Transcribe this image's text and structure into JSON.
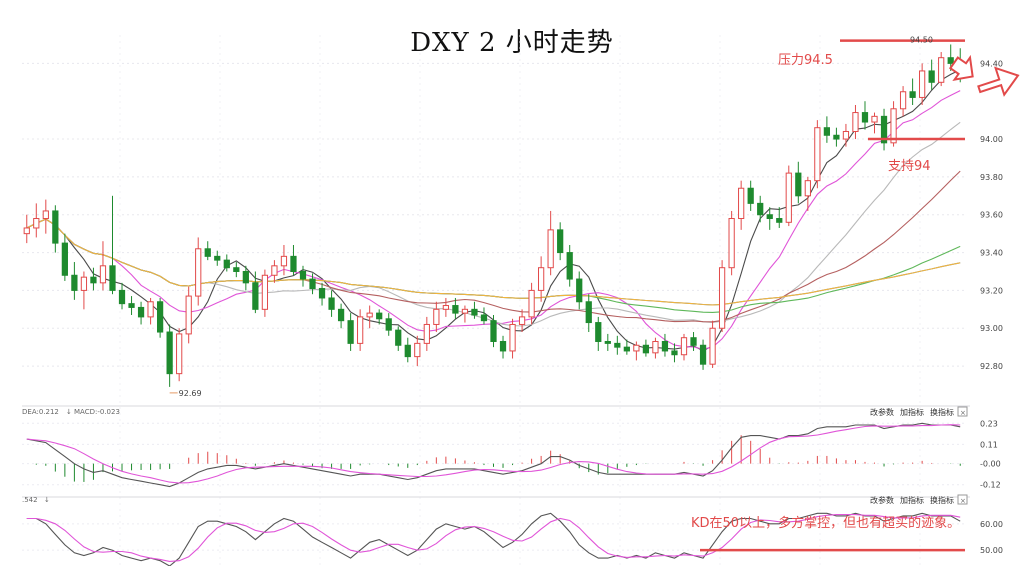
{
  "title": "DXY 2 小时走势",
  "chart_data": {
    "type": "candlestick",
    "symbol": "DXY",
    "price_axis": {
      "ticks": [
        "94.40",
        "94.00",
        "93.80",
        "93.60",
        "93.40",
        "93.20",
        "93.00",
        "92.80"
      ],
      "range": [
        92.7,
        94.55
      ]
    },
    "high_label": "94.50",
    "low_label": "92.69",
    "annotations": {
      "resistance": "压力94.5",
      "support": "支持94",
      "kd_note": "KD在50以上，多方掌控，但也有超买的迹象。"
    },
    "colors": {
      "up": "#e24a4a",
      "down": "#1e8a2e",
      "ann": "#e24a4a"
    },
    "macd": {
      "label_dea": "DEA:0.212",
      "label_macd": "MACD:-0.023",
      "ticks": [
        "0.23",
        "0.11",
        "-0.00",
        "-0.12"
      ],
      "range": [
        -0.15,
        0.26
      ]
    },
    "kd": {
      "label": ".542",
      "ticks": [
        "60.00",
        "50.00"
      ],
      "range": [
        44,
        66
      ]
    },
    "buttons": [
      "改参数",
      "加指标",
      "换指标"
    ],
    "candles": [
      [
        93.5,
        93.6,
        93.45,
        93.53
      ],
      [
        93.53,
        93.66,
        93.48,
        93.58
      ],
      [
        93.58,
        93.68,
        93.5,
        93.62
      ],
      [
        93.62,
        93.65,
        93.4,
        93.45
      ],
      [
        93.45,
        93.5,
        93.25,
        93.28
      ],
      [
        93.28,
        93.35,
        93.15,
        93.2
      ],
      [
        93.2,
        93.3,
        93.1,
        93.27
      ],
      [
        93.27,
        93.32,
        93.2,
        93.24
      ],
      [
        93.24,
        93.46,
        93.2,
        93.33
      ],
      [
        93.33,
        93.7,
        93.18,
        93.2
      ],
      [
        93.2,
        93.24,
        93.1,
        93.13
      ],
      [
        93.13,
        93.17,
        93.07,
        93.11
      ],
      [
        93.11,
        93.14,
        93.02,
        93.06
      ],
      [
        93.06,
        93.16,
        93.02,
        93.14
      ],
      [
        93.14,
        93.16,
        92.95,
        92.98
      ],
      [
        92.98,
        93.02,
        92.69,
        92.76
      ],
      [
        92.76,
        93.0,
        92.72,
        92.97
      ],
      [
        92.97,
        93.22,
        92.92,
        93.17
      ],
      [
        93.17,
        93.48,
        93.12,
        93.42
      ],
      [
        93.42,
        93.46,
        93.36,
        93.38
      ],
      [
        93.38,
        93.41,
        93.33,
        93.36
      ],
      [
        93.36,
        93.39,
        93.3,
        93.32
      ],
      [
        93.32,
        93.35,
        93.27,
        93.3
      ],
      [
        93.3,
        93.33,
        93.2,
        93.24
      ],
      [
        93.24,
        93.3,
        93.08,
        93.1
      ],
      [
        93.1,
        93.31,
        93.06,
        93.28
      ],
      [
        93.28,
        93.36,
        93.24,
        93.33
      ],
      [
        93.33,
        93.44,
        93.28,
        93.38
      ],
      [
        93.38,
        93.44,
        93.28,
        93.3
      ],
      [
        93.3,
        93.33,
        93.22,
        93.26
      ],
      [
        93.26,
        93.29,
        93.18,
        93.21
      ],
      [
        93.21,
        93.24,
        93.12,
        93.16
      ],
      [
        93.16,
        93.2,
        93.06,
        93.1
      ],
      [
        93.1,
        93.13,
        93.0,
        93.04
      ],
      [
        93.04,
        93.08,
        92.88,
        92.92
      ],
      [
        92.92,
        93.1,
        92.88,
        93.06
      ],
      [
        93.06,
        93.12,
        93.0,
        93.08
      ],
      [
        93.08,
        93.1,
        93.02,
        93.05
      ],
      [
        93.05,
        93.08,
        92.96,
        92.99
      ],
      [
        92.99,
        93.01,
        92.88,
        92.91
      ],
      [
        92.91,
        92.95,
        92.82,
        92.85
      ],
      [
        92.85,
        92.96,
        92.8,
        92.92
      ],
      [
        92.92,
        93.06,
        92.88,
        93.02
      ],
      [
        93.02,
        93.14,
        92.98,
        93.1
      ],
      [
        93.1,
        93.16,
        93.06,
        93.12
      ],
      [
        93.12,
        93.16,
        93.05,
        93.08
      ],
      [
        93.08,
        93.12,
        93.03,
        93.1
      ],
      [
        93.1,
        93.14,
        93.05,
        93.07
      ],
      [
        93.07,
        93.11,
        93.02,
        93.04
      ],
      [
        93.04,
        93.07,
        92.9,
        92.93
      ],
      [
        92.93,
        92.96,
        92.84,
        92.88
      ],
      [
        92.88,
        93.05,
        92.84,
        93.02
      ],
      [
        93.02,
        93.1,
        92.98,
        93.06
      ],
      [
        93.06,
        93.24,
        93.02,
        93.2
      ],
      [
        93.2,
        93.38,
        93.14,
        93.32
      ],
      [
        93.32,
        93.62,
        93.28,
        93.52
      ],
      [
        93.52,
        93.56,
        93.36,
        93.4
      ],
      [
        93.4,
        93.44,
        93.22,
        93.26
      ],
      [
        93.26,
        93.3,
        93.1,
        93.14
      ],
      [
        93.14,
        93.18,
        92.98,
        93.03
      ],
      [
        93.03,
        93.06,
        92.88,
        92.93
      ],
      [
        92.93,
        92.97,
        92.88,
        92.92
      ],
      [
        92.92,
        92.96,
        92.86,
        92.9
      ],
      [
        92.9,
        92.94,
        92.86,
        92.88
      ],
      [
        92.88,
        92.93,
        92.83,
        92.91
      ],
      [
        92.91,
        92.94,
        92.85,
        92.87
      ],
      [
        92.87,
        92.95,
        92.84,
        92.93
      ],
      [
        92.93,
        92.97,
        92.85,
        92.88
      ],
      [
        92.88,
        92.92,
        92.82,
        92.86
      ],
      [
        92.86,
        92.97,
        92.83,
        92.95
      ],
      [
        92.95,
        92.98,
        92.88,
        92.91
      ],
      [
        92.91,
        92.94,
        92.78,
        92.81
      ],
      [
        92.81,
        93.04,
        92.79,
        93.0
      ],
      [
        93.0,
        93.36,
        92.98,
        93.32
      ],
      [
        93.32,
        93.62,
        93.28,
        93.58
      ],
      [
        93.58,
        93.78,
        93.52,
        93.74
      ],
      [
        93.74,
        93.78,
        93.62,
        93.66
      ],
      [
        93.66,
        93.7,
        93.56,
        93.6
      ],
      [
        93.6,
        93.64,
        93.52,
        93.58
      ],
      [
        93.58,
        93.64,
        93.53,
        93.56
      ],
      [
        93.56,
        93.86,
        93.54,
        93.82
      ],
      [
        93.82,
        93.88,
        93.66,
        93.7
      ],
      [
        93.7,
        93.8,
        93.62,
        93.78
      ],
      [
        93.78,
        94.1,
        93.74,
        94.06
      ],
      [
        94.06,
        94.12,
        93.98,
        94.02
      ],
      [
        94.02,
        94.06,
        93.96,
        94.0
      ],
      [
        94.0,
        94.08,
        93.96,
        94.04
      ],
      [
        94.04,
        94.18,
        94.0,
        94.14
      ],
      [
        94.14,
        94.2,
        94.05,
        94.09
      ],
      [
        94.09,
        94.14,
        94.03,
        94.12
      ],
      [
        94.12,
        94.16,
        93.94,
        93.98
      ],
      [
        93.98,
        94.2,
        93.96,
        94.16
      ],
      [
        94.16,
        94.28,
        94.12,
        94.25
      ],
      [
        94.25,
        94.32,
        94.18,
        94.22
      ],
      [
        94.22,
        94.4,
        94.18,
        94.36
      ],
      [
        94.36,
        94.42,
        94.26,
        94.3
      ],
      [
        94.3,
        94.46,
        94.28,
        94.43
      ],
      [
        94.43,
        94.5,
        94.36,
        94.4
      ],
      [
        94.4,
        94.48,
        94.3,
        94.34
      ]
    ],
    "macd_values": [
      0.14,
      0.13,
      0.12,
      0.08,
      0.04,
      0.0,
      -0.03,
      -0.05,
      -0.04,
      -0.06,
      -0.08,
      -0.09,
      -0.1,
      -0.11,
      -0.12,
      -0.13,
      -0.11,
      -0.08,
      -0.05,
      -0.03,
      -0.02,
      -0.01,
      -0.01,
      -0.02,
      -0.03,
      -0.02,
      -0.01,
      0.0,
      -0.01,
      -0.02,
      -0.03,
      -0.04,
      -0.05,
      -0.06,
      -0.07,
      -0.06,
      -0.06,
      -0.06,
      -0.07,
      -0.08,
      -0.09,
      -0.08,
      -0.06,
      -0.04,
      -0.03,
      -0.03,
      -0.03,
      -0.03,
      -0.04,
      -0.05,
      -0.06,
      -0.05,
      -0.04,
      -0.02,
      0.0,
      0.04,
      0.04,
      0.02,
      -0.01,
      -0.03,
      -0.05,
      -0.06,
      -0.06,
      -0.06,
      -0.06,
      -0.06,
      -0.06,
      -0.06,
      -0.06,
      -0.05,
      -0.06,
      -0.07,
      -0.04,
      0.02,
      0.09,
      0.15,
      0.16,
      0.16,
      0.15,
      0.14,
      0.16,
      0.16,
      0.17,
      0.2,
      0.21,
      0.21,
      0.21,
      0.22,
      0.22,
      0.22,
      0.2,
      0.21,
      0.22,
      0.22,
      0.23,
      0.22,
      0.22,
      0.22,
      0.21
    ],
    "k_values": [
      62,
      62,
      60,
      56,
      52,
      49,
      48,
      49,
      51,
      50,
      48,
      47,
      46,
      47,
      46,
      44,
      47,
      53,
      59,
      61,
      61,
      60,
      59,
      57,
      54,
      57,
      60,
      62,
      61,
      58,
      55,
      53,
      51,
      49,
      47,
      50,
      53,
      54,
      52,
      50,
      48,
      50,
      54,
      58,
      60,
      59,
      58,
      59,
      57,
      54,
      51,
      53,
      56,
      60,
      63,
      64,
      61,
      57,
      52,
      49,
      47,
      47,
      48,
      47,
      48,
      47,
      49,
      48,
      47,
      49,
      48,
      47,
      52,
      57,
      61,
      62,
      62,
      61,
      60,
      60,
      62,
      62,
      63,
      64,
      64,
      63,
      63,
      64,
      63,
      63,
      61,
      62,
      63,
      63,
      64,
      63,
      63,
      63,
      61
    ]
  }
}
